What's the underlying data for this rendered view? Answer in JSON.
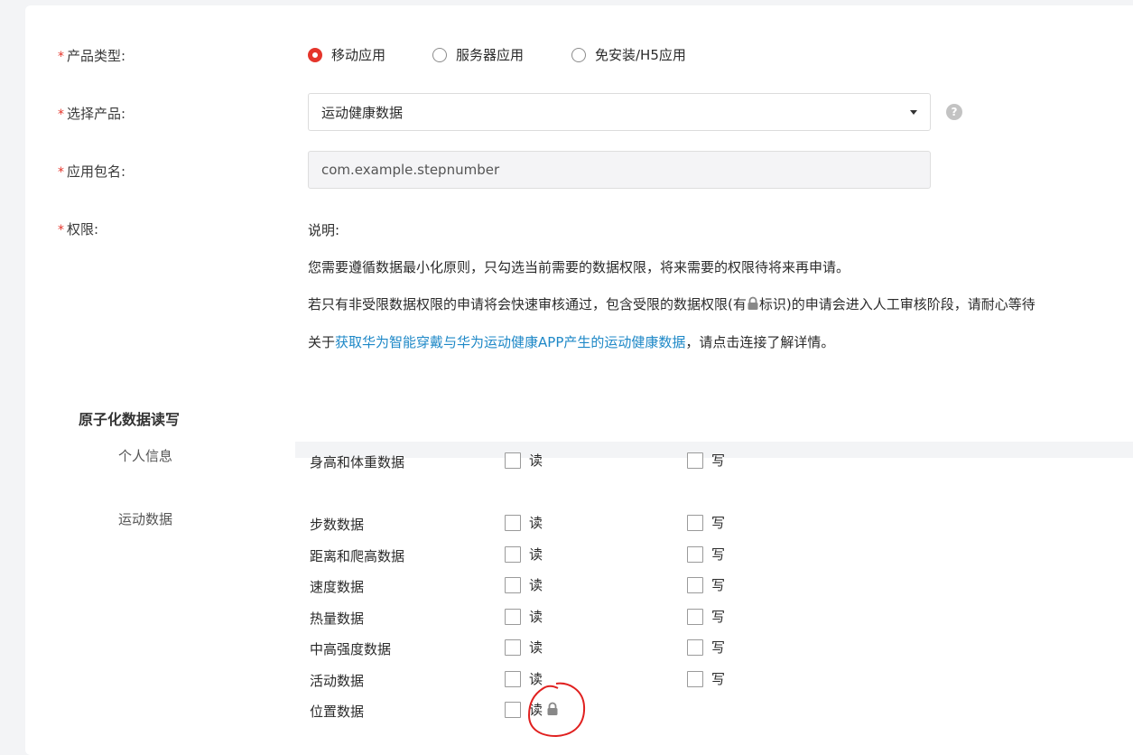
{
  "form": {
    "product_type": {
      "label": "产品类型:",
      "options": [
        {
          "label": "移动应用",
          "checked": true
        },
        {
          "label": "服务器应用",
          "checked": false
        },
        {
          "label": "免安装/H5应用",
          "checked": false
        }
      ]
    },
    "select_product": {
      "label": "选择产品:",
      "value": "运动健康数据",
      "help_icon": "?"
    },
    "package_name": {
      "label": "应用包名:",
      "value": "com.example.stepnumber"
    },
    "permissions": {
      "label": "权限:",
      "desc_title": "说明:",
      "desc_line1": "您需要遵循数据最小化原则，只勾选当前需要的数据权限，将来需要的权限待将来再申请。",
      "desc_line2_a": "若只有非受限数据权限的申请将会快速审核通过，包含受限的数据权限(有",
      "desc_line2_b": "标识)的申请会进入人工审核阶段，请耐心等待",
      "desc_line3_a": "关于",
      "desc_line3_link": "获取华为智能穿戴与华为运动健康APP产生的运动健康数据",
      "desc_line3_b": "，请点击连接了解详情。"
    },
    "required_mark": "*"
  },
  "atomic": {
    "title": "原子化数据读写",
    "read_label": "读",
    "write_label": "写",
    "groups": [
      {
        "name": "个人信息",
        "items": [
          "身高和体重数据"
        ]
      },
      {
        "name": "运动数据",
        "items": [
          "步数数据",
          "距离和爬高数据",
          "速度数据",
          "热量数据",
          "中高强度数据",
          "活动数据",
          "位置数据"
        ]
      }
    ]
  },
  "colors": {
    "accent": "#e5352b",
    "link": "#1e88c7",
    "annotation": "#e0201f"
  }
}
